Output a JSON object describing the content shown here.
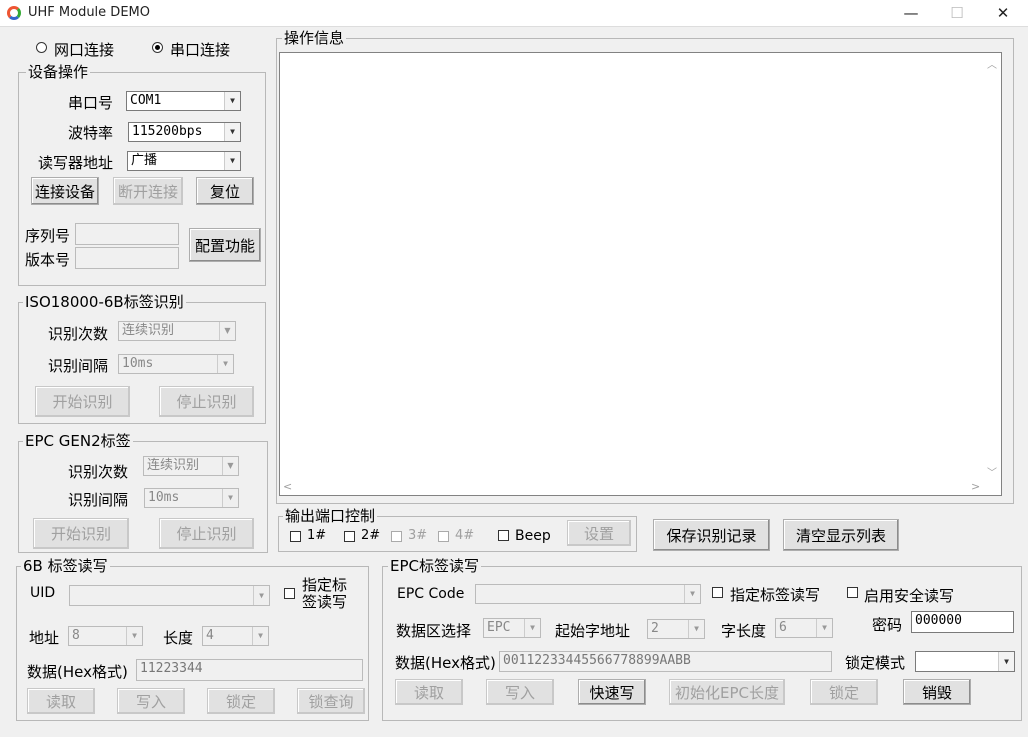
{
  "window": {
    "title": "UHF Module DEMO",
    "minimize": "—",
    "maximize": "☐",
    "close": "✕"
  },
  "conn": {
    "network": "网口连接",
    "serial": "串口连接"
  },
  "device": {
    "group": "设备操作",
    "port_label": "串口号",
    "port_value": "COM1",
    "baud_label": "波特率",
    "baud_value": "115200bps",
    "addr_label": "读写器地址",
    "addr_value": "广播",
    "connect": "连接设备",
    "disconnect": "断开连接",
    "reset": "复位",
    "serial_label": "序列号",
    "version_label": "版本号",
    "config": "配置功能"
  },
  "iso6b": {
    "group": "ISO18000-6B标签识别",
    "count_label": "识别次数",
    "count_value": "连续识别",
    "interval_label": "识别间隔",
    "interval_value": "10ms",
    "start": "开始识别",
    "stop": "停止识别"
  },
  "gen2": {
    "group": "EPC GEN2标签",
    "count_label": "识别次数",
    "count_value": "连续识别",
    "interval_label": "识别间隔",
    "interval_value": "10ms",
    "start": "开始识别",
    "stop": "停止识别"
  },
  "log": {
    "group": "操作信息"
  },
  "output": {
    "group": "输出端口控制",
    "p1": "1#",
    "p2": "2#",
    "p3": "3#",
    "p4": "4#",
    "beep": "Beep",
    "set": "设置"
  },
  "save_btn": "保存识别记录",
  "clear_btn": "清空显示列表",
  "rw6b": {
    "group": "6B 标签读写",
    "uid_label": "UID",
    "specify_line1": "指定标",
    "specify_line2": "签读写",
    "addr_label": "地址",
    "addr_value": "8",
    "len_label": "长度",
    "len_value": "4",
    "data_label": "数据(Hex格式)",
    "data_value": "11223344",
    "read": "读取",
    "write": "写入",
    "lock": "锁定",
    "lock_query": "锁查询"
  },
  "epc": {
    "group": "EPC标签读写",
    "code_label": "EPC Code",
    "specify": "指定标签读写",
    "secure": "启用安全读写",
    "area_label": "数据区选择",
    "area_value": "EPC",
    "start_label": "起始字地址",
    "start_value": "2",
    "wlen_label": "字长度",
    "wlen_value": "6",
    "pwd_label": "密码",
    "pwd_value": "000000",
    "data_label": "数据(Hex格式)",
    "data_value": "00112233445566778899AABB",
    "lockmode_label": "锁定模式",
    "read": "读取",
    "write": "写入",
    "fast": "快速写",
    "init": "初始化EPC长度",
    "lock": "锁定",
    "kill": "销毁"
  }
}
